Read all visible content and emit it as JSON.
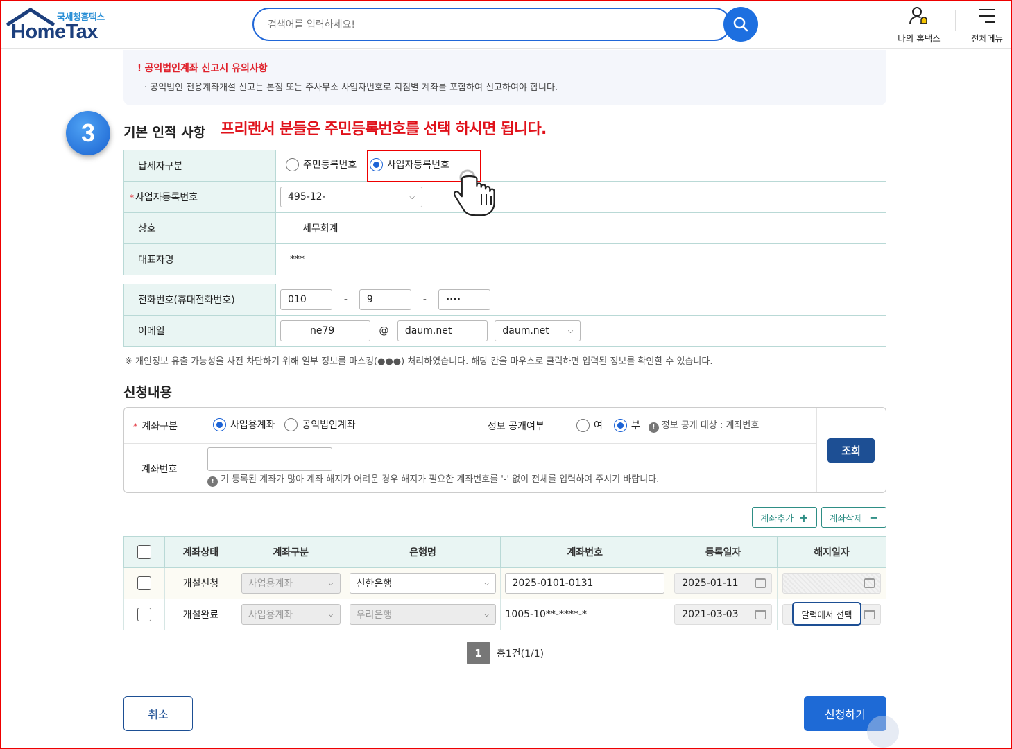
{
  "header": {
    "logo_sub": "국세청홈택스",
    "logo_main": "HomeTax",
    "search_placeholder": "검색어를 입력하세요!",
    "my_hometax": "나의 홈택스",
    "all_menu": "전체메뉴"
  },
  "notice": {
    "title": "공익법인계좌 신고시 유의사항",
    "detail": "공익법인 전용계좌개설 신고는 본점 또는 주사무소 사업자번호로 지점별 계좌를 포함하여 신고하여야 합니다."
  },
  "step_number": "3",
  "basic": {
    "title": "기본 인적 사항",
    "annotation": "프리랜서 분들은 주민등록번호를 선택 하시면 됩니다.",
    "taxpayer_type_label": "납세자구분",
    "option_resident": "주민등록번호",
    "option_business": "사업자등록번호",
    "selected_option": "사업자등록번호",
    "brn_label": "사업자등록번호",
    "brn_value": "495-12-",
    "company_label": "상호",
    "company_value": "세무회계",
    "rep_label": "대표자명",
    "rep_value": "***",
    "phone_label": "전화번호(휴대전화번호)",
    "phone_1": "010",
    "phone_sep": "-",
    "phone_2": "9",
    "phone_3": "····",
    "email_label": "이메일",
    "email_id": "ne79",
    "email_at": "@",
    "email_domain": "daum.net",
    "email_domain_select": "daum.net"
  },
  "mask_note": "※ 개인정보 유출 가능성을 사전 차단하기 위해 일부 정보를 마스킹(●●●) 처리하였습니다. 해당 칸을 마우스로 클릭하면 입력된 정보를 확인할 수 있습니다.",
  "apply": {
    "title": "신청내용",
    "account_type_label": "계좌구분",
    "opt_business_account": "사업용계좌",
    "opt_public_account": "공익법인계좌",
    "disclosure_label": "정보 공개여부",
    "opt_yes": "여",
    "opt_no": "부",
    "disclosure_info": "정보 공개 대상 : 계좌번호",
    "account_no_label": "계좌번호",
    "account_hint": "기 등록된 계좌가 많아 계좌 해지가 어려운 경우 해지가 필요한 계좌번호를 '-' 없이 전체를 입력하여 주시기 바랍니다.",
    "query_button": "조회"
  },
  "actions": {
    "add_account": "계좌추가",
    "delete_account": "계좌삭제",
    "cancel": "취소",
    "submit": "신청하기"
  },
  "grid": {
    "headers": [
      "계좌상태",
      "계좌구분",
      "은행명",
      "계좌번호",
      "등록일자",
      "해지일자"
    ],
    "rows": [
      {
        "status": "개설신청",
        "type": "사업용계좌",
        "bank": "신한은행",
        "account": "2025-0101-0131",
        "reg_date": "2025-01-11",
        "close_date": ""
      },
      {
        "status": "개설완료",
        "type": "사업용계좌",
        "bank": "우리은행",
        "account": "1005-10**-****-*",
        "reg_date": "2021-03-03",
        "close_date": ""
      }
    ],
    "tooltip": "달력에서 선택"
  },
  "pager": {
    "current": "1",
    "total_text": "총1건(1/1)"
  }
}
